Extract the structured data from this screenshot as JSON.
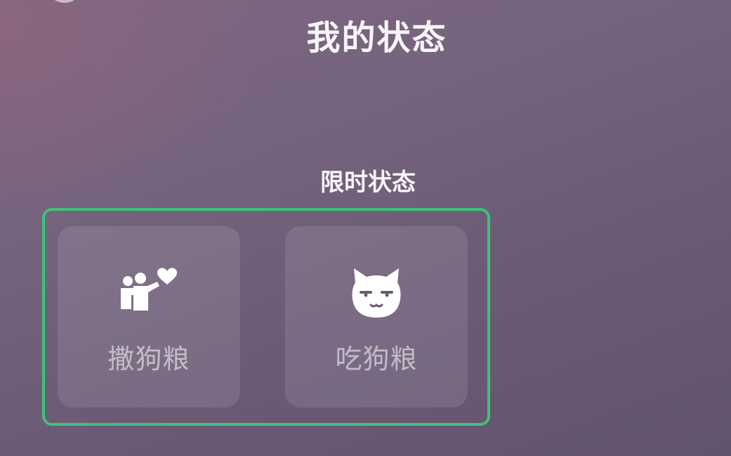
{
  "header": {
    "title": "我的状态"
  },
  "section": {
    "title": "限时状态"
  },
  "statuses": [
    {
      "label": "撒狗粮",
      "icon": "couple-heart-icon"
    },
    {
      "label": "吃狗粮",
      "icon": "cat-face-icon"
    }
  ],
  "colors": {
    "highlight": "#3dc27a",
    "background": "#6b5a75"
  }
}
